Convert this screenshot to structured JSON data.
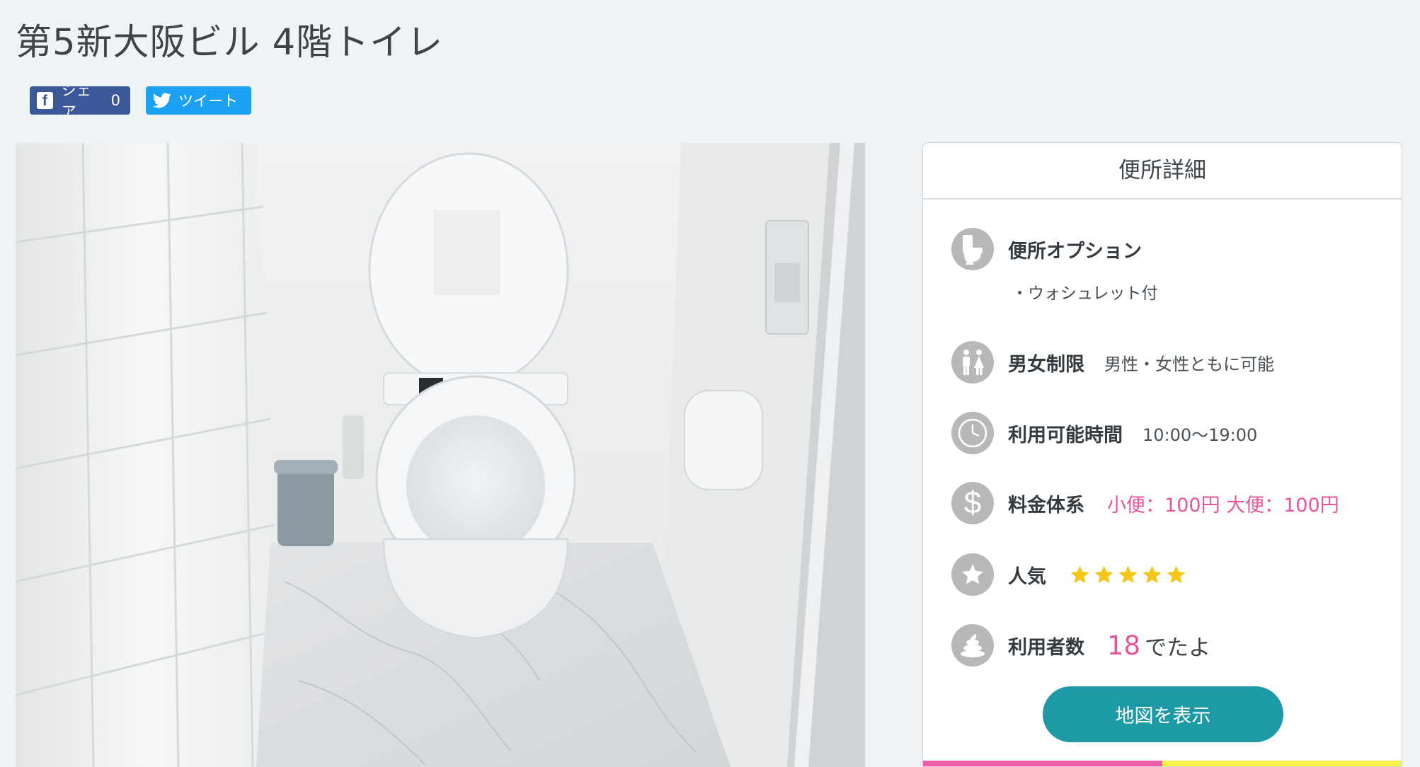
{
  "page": {
    "title": "第5新大阪ビル 4階トイレ"
  },
  "share": {
    "facebook_label": "シェア",
    "facebook_count": "0",
    "twitter_label": "ツイート"
  },
  "detail": {
    "header": "便所詳細",
    "options": {
      "label": "便所オプション",
      "items": [
        "・ウォシュレット付"
      ],
      "icon": "toilet-icon"
    },
    "gender": {
      "label": "男女制限",
      "value": "男性・女性ともに可能",
      "icon": "restroom-people-icon"
    },
    "hours": {
      "label": "利用可能時間",
      "value": "10:00〜19:00",
      "icon": "clock-icon"
    },
    "price": {
      "label": "料金体系",
      "value": "小便：100円 大便：100円",
      "icon": "dollar-icon"
    },
    "popularity": {
      "label": "人気",
      "stars": 5,
      "max_stars": 5,
      "icon": "star-icon"
    },
    "users": {
      "label": "利用者数",
      "count": "18",
      "suffix": "でたよ",
      "icon": "poop-icon"
    },
    "map_button": "地図を表示"
  },
  "colors": {
    "accent_teal": "#1e9aa6",
    "pink": "#e9559a",
    "facebook": "#3b5998",
    "twitter": "#1da1f2",
    "star": "#f5c518",
    "strip_pink": "#ef5fa7",
    "strip_yellow": "#f7f24a"
  }
}
